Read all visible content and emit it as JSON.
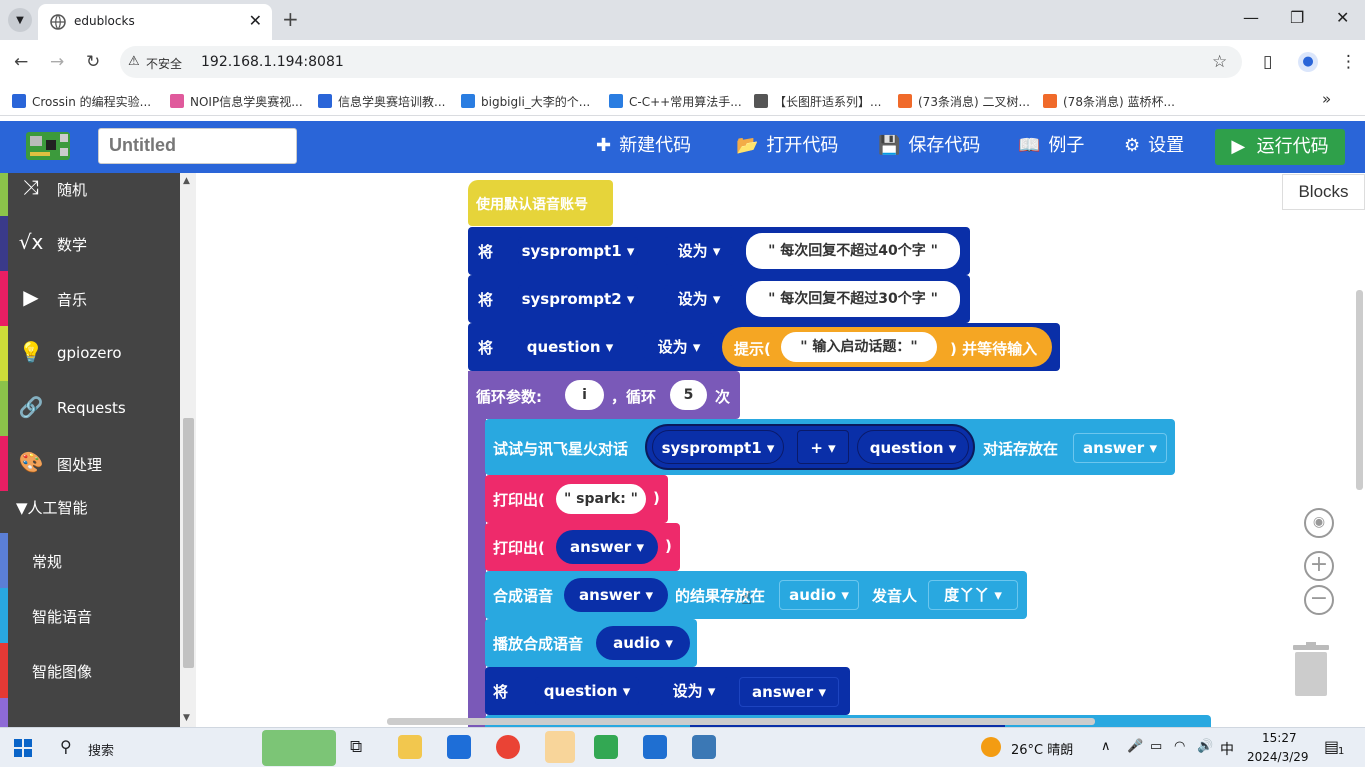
{
  "browser": {
    "tab_title": "edublocks",
    "tab_close": "✕",
    "new_tab": "+",
    "security_label": "不安全",
    "url": "192.168.1.194:8081",
    "window_controls": {
      "minimize": "—",
      "restore": "❐",
      "close": "✕"
    }
  },
  "bookmarks": [
    {
      "label": "Crossin 的编程实验...",
      "color": "#2a65d8"
    },
    {
      "label": "NOIP信息学奥赛视...",
      "color": "#e05a9c"
    },
    {
      "label": "信息学奥赛培训教...",
      "color": "#2a65d8"
    },
    {
      "label": "bigbigli_大李的个...",
      "color": "#2a7de1"
    },
    {
      "label": "C-C++常用算法手...",
      "color": "#2a7de1"
    },
    {
      "label": "【长图肝适系列】...",
      "color": "#555555"
    },
    {
      "label": "(73条消息) 二叉树...",
      "color": "#f06a2a"
    },
    {
      "label": "(78条消息) 蓝桥杯...",
      "color": "#f06a2a"
    }
  ],
  "bookmarks_more": "»",
  "app": {
    "project_name": "Untitled",
    "menu": {
      "new_code": "新建代码",
      "open_code": "打开代码",
      "save_code": "保存代码",
      "examples": "例子",
      "settings": "设置",
      "run_code": "运行代码"
    }
  },
  "sidebar": {
    "categories": [
      {
        "label": "随机",
        "color": "#8bc34a"
      },
      {
        "label": "数学",
        "color": "#3a3a8a"
      },
      {
        "label": "音乐",
        "color": "#e91e63"
      },
      {
        "label": "gpiozero",
        "color": "#cddc39"
      },
      {
        "label": "Requests",
        "color": "#8bc34a"
      },
      {
        "label": "图处理",
        "color": "#e91e63"
      }
    ],
    "group": "▼人工智能",
    "subcategories": [
      {
        "label": "常规",
        "color": "#5b7fd6"
      },
      {
        "label": "智能语音",
        "color": "#29a8e0"
      },
      {
        "label": "智能图像",
        "color": "#e53935"
      }
    ]
  },
  "workspace": {
    "flyout_tab": "Blocks",
    "blocks": {
      "use_default_account": "使用默认语音账号",
      "set1": {
        "kw": "将",
        "var": "sysprompt1",
        "set": "设为",
        "value": "\" 每次回复不超过40个字 \""
      },
      "set2": {
        "kw": "将",
        "var": "sysprompt2",
        "set": "设为",
        "value": "\" 每次回复不超过30个字 \""
      },
      "set3": {
        "kw": "将",
        "var": "question",
        "set": "设为",
        "prompt_open": "提示(",
        "prompt_text": "\" 输入启动话题：\"",
        "prompt_close": ") 并等待输入"
      },
      "loop": {
        "label": "循环参数:",
        "var": "i",
        "sep": "，循环",
        "count": "5",
        "suffix": "次"
      },
      "spark": {
        "label": "试试与讯飞星火对话",
        "arg1": "sysprompt1",
        "op": "+",
        "arg2": "question",
        "store": "对话存放在",
        "result": "answer"
      },
      "print1": {
        "label": "打印出(",
        "value": "\" spark: \"",
        "close": ")"
      },
      "print2": {
        "label": "打印出(",
        "value": "answer",
        "close": ")"
      },
      "tts": {
        "label": "合成语音",
        "text": "answer",
        "store": "的结果存放在",
        "var": "audio",
        "voice_label": "发音人",
        "voice": "度丫丫"
      },
      "play": {
        "label": "播放合成语音",
        "var": "audio"
      },
      "set4": {
        "kw": "将",
        "var": "question",
        "set": "设为",
        "value": "answer"
      }
    }
  },
  "taskbar": {
    "search": "搜索",
    "weather": "26°C  晴朗",
    "ime": "中",
    "time": "15:27",
    "date": "2024/3/29",
    "notif": "1"
  }
}
